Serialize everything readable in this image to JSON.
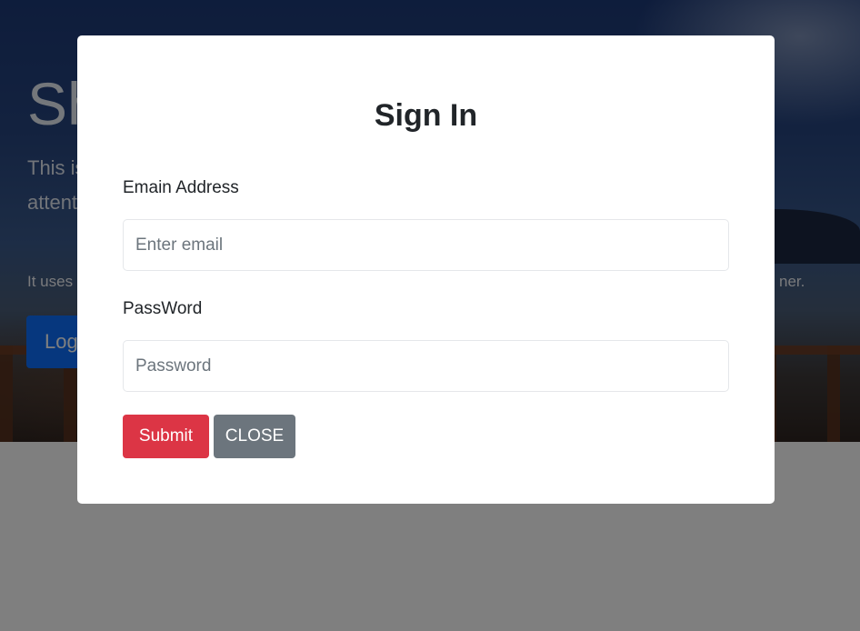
{
  "hero": {
    "title": "Sh",
    "lead": "This is attent",
    "body": "It uses ner.",
    "cta_label": "Log"
  },
  "modal": {
    "title": "Sign In",
    "email": {
      "label": "Emain Address",
      "placeholder": "Enter email",
      "value": ""
    },
    "password": {
      "label": "PassWord",
      "placeholder": "Password",
      "value": ""
    },
    "submit_label": "Submit",
    "close_label": "CLOSE"
  },
  "colors": {
    "submit": "#dc3545",
    "close": "#6c757d",
    "backdrop": "rgba(0,0,0,0.5)",
    "hero_cta": "#0d6efd"
  }
}
